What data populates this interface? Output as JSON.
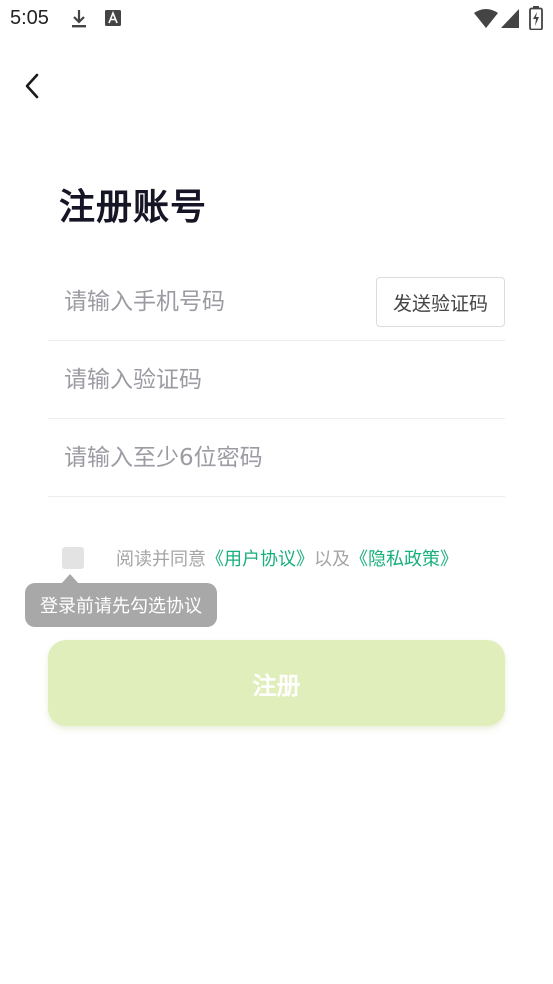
{
  "status_bar": {
    "time": "5:05",
    "icons": [
      "download-icon",
      "font-icon",
      "wifi-icon",
      "signal-icon",
      "battery-charging-icon"
    ]
  },
  "nav": {
    "back_icon": "chevron-left-icon"
  },
  "page": {
    "title": "注册账号"
  },
  "form": {
    "phone": {
      "placeholder": "请输入手机号码",
      "value": ""
    },
    "send_code_label": "发送验证码",
    "code": {
      "placeholder": "请输入验证码",
      "value": ""
    },
    "password": {
      "placeholder": "请输入至少6位密码",
      "value": ""
    }
  },
  "agreement": {
    "checked": false,
    "prefix": "阅读并同意",
    "user_agreement": "《用户协议》",
    "connector": "以及",
    "privacy_policy": "《隐私政策》",
    "tooltip": "登录前请先勾选协议"
  },
  "register_label": "注册",
  "colors": {
    "link": "#18b07a",
    "register_bg": "#e0eebb",
    "tooltip_bg": "#a8a8a8",
    "title": "#151525"
  }
}
